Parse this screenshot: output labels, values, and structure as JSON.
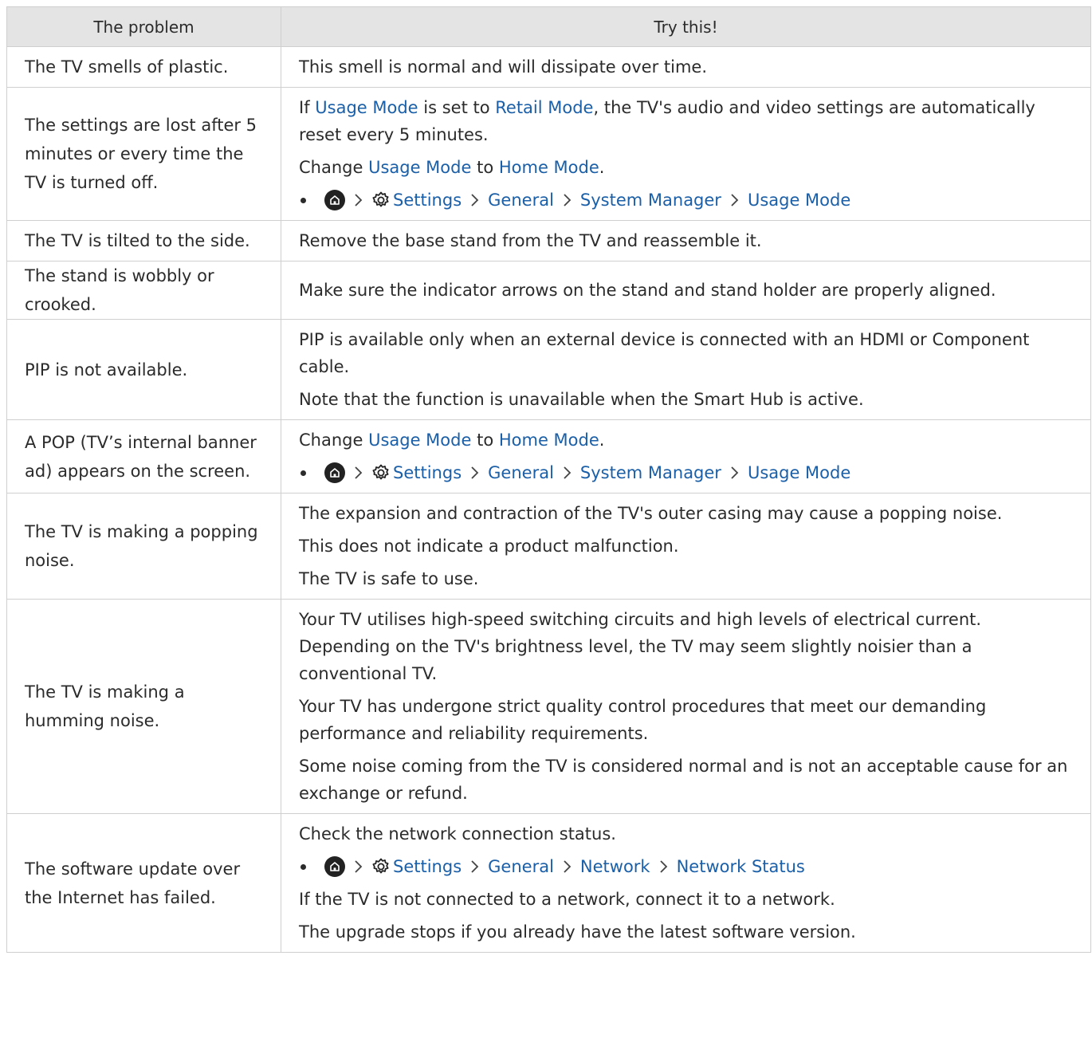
{
  "header": {
    "problem": "The problem",
    "solution": "Try this!"
  },
  "rows": [
    {
      "problem": "The TV smells of plastic.",
      "solution": [
        {
          "type": "text",
          "parts": [
            {
              "t": "This smell is normal and will dissipate over time."
            }
          ]
        }
      ]
    },
    {
      "problem": "The settings are lost after 5 minutes or every time the TV is turned off.",
      "solution": [
        {
          "type": "text",
          "parts": [
            {
              "t": "If "
            },
            {
              "t": "Usage Mode",
              "k": 1
            },
            {
              "t": " is set to "
            },
            {
              "t": "Retail Mode",
              "k": 1
            },
            {
              "t": ", the TV's audio and video settings are automatically reset every 5 minutes."
            }
          ]
        },
        {
          "type": "text",
          "parts": [
            {
              "t": "Change "
            },
            {
              "t": "Usage Mode",
              "k": 1
            },
            {
              "t": " to "
            },
            {
              "t": "Home Mode",
              "k": 1
            },
            {
              "t": "."
            }
          ]
        },
        {
          "type": "path",
          "items": [
            "Settings",
            "General",
            "System Manager",
            "Usage Mode"
          ]
        }
      ]
    },
    {
      "problem": "The TV is tilted to the side.",
      "solution": [
        {
          "type": "text",
          "parts": [
            {
              "t": "Remove the base stand from the TV and reassemble it."
            }
          ]
        }
      ]
    },
    {
      "problem": "The stand is wobbly or crooked.",
      "solution": [
        {
          "type": "text",
          "parts": [
            {
              "t": "Make sure the indicator arrows on the stand and stand holder are properly aligned."
            }
          ]
        }
      ]
    },
    {
      "problem": "PIP is not available.",
      "solution": [
        {
          "type": "text",
          "parts": [
            {
              "t": "PIP is available only when an external device is connected with an HDMI or Component cable."
            }
          ]
        },
        {
          "type": "text",
          "parts": [
            {
              "t": "Note that the function is unavailable when the Smart Hub is active."
            }
          ]
        }
      ]
    },
    {
      "problem": "A POP (TV’s internal banner ad) appears on the screen.",
      "solution": [
        {
          "type": "text",
          "parts": [
            {
              "t": "Change "
            },
            {
              "t": "Usage Mode",
              "k": 1
            },
            {
              "t": " to "
            },
            {
              "t": "Home Mode",
              "k": 1
            },
            {
              "t": "."
            }
          ]
        },
        {
          "type": "path",
          "items": [
            "Settings",
            "General",
            "System Manager",
            "Usage Mode"
          ]
        }
      ]
    },
    {
      "problem": "The TV is making a popping noise.",
      "solution": [
        {
          "type": "text",
          "parts": [
            {
              "t": "The expansion and contraction of the TV's outer casing may cause a popping noise."
            }
          ]
        },
        {
          "type": "text",
          "parts": [
            {
              "t": "This does not indicate a product malfunction."
            }
          ]
        },
        {
          "type": "text",
          "parts": [
            {
              "t": "The TV is safe to use."
            }
          ]
        }
      ]
    },
    {
      "problem": "The TV is making a humming noise.",
      "solution": [
        {
          "type": "text",
          "parts": [
            {
              "t": "Your TV utilises high-speed switching circuits and high levels of electrical current. Depending on the TV's brightness level, the TV may seem slightly noisier than a conventional TV."
            }
          ]
        },
        {
          "type": "text",
          "parts": [
            {
              "t": "Your TV has undergone strict quality control procedures that meet our demanding performance and reliability requirements."
            }
          ]
        },
        {
          "type": "text",
          "parts": [
            {
              "t": "Some noise coming from the TV is considered normal and is not an acceptable cause for an exchange or refund."
            }
          ]
        }
      ]
    },
    {
      "problem": "The software update over the Internet has failed.",
      "solution": [
        {
          "type": "text",
          "parts": [
            {
              "t": "Check the network connection status."
            }
          ]
        },
        {
          "type": "path",
          "items": [
            "Settings",
            "General",
            "Network",
            "Network Status"
          ]
        },
        {
          "type": "text",
          "parts": [
            {
              "t": "If the TV is not connected to a network, connect it to a network."
            }
          ]
        },
        {
          "type": "text",
          "parts": [
            {
              "t": "The upgrade stops if you already have the latest software version."
            }
          ]
        }
      ]
    }
  ],
  "icons": {
    "home": "home-icon",
    "settings": "gear-icon",
    "separator": "chevron-right-icon"
  },
  "colors": {
    "link": "#1a5fa8",
    "header_bg": "#e4e4e4",
    "border": "#cfcfcf",
    "text": "#2b2b2b"
  }
}
